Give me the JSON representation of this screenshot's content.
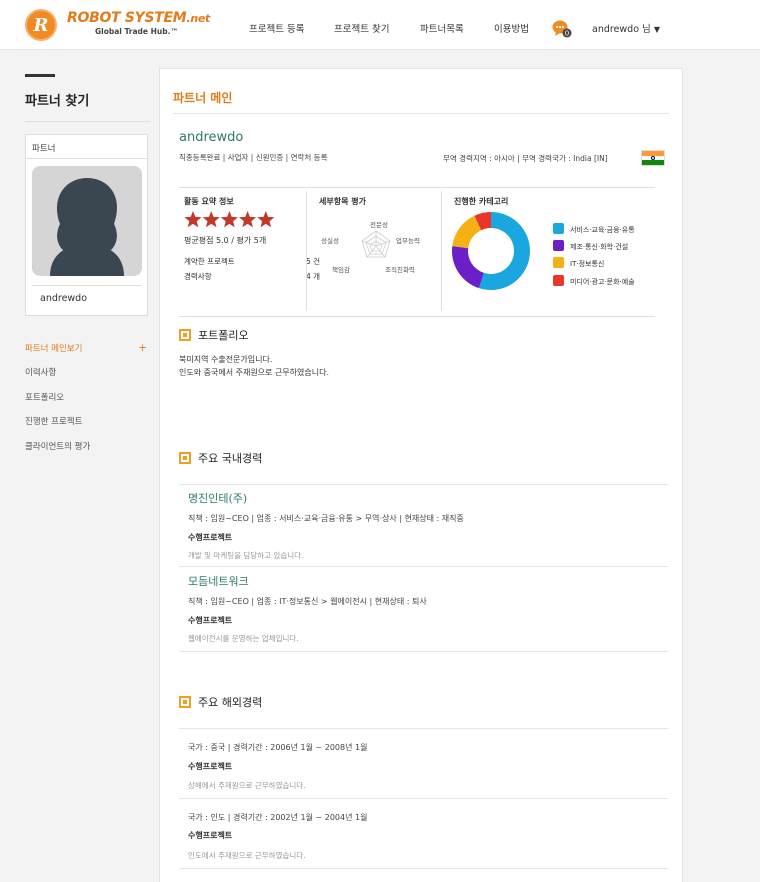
{
  "header": {
    "logo_text": "ROBOT SYSTEM",
    "logo_suffix": ".net",
    "logo_tagline": "Global Trade Hub.™",
    "nav": [
      "프로젝트 등록",
      "프로젝트 찾기",
      "파트너목록",
      "이용방법"
    ],
    "message_count": "0",
    "user_label": "andrewdo 님"
  },
  "sidebar": {
    "title": "파트너 찾기",
    "card_header": "파트너",
    "card_name": "andrewdo",
    "menu": [
      "파트너 메인보기",
      "이력사항",
      "포트폴리오",
      "진행한 프로젝트",
      "클라이언트의 평가"
    ],
    "plus": "+"
  },
  "main": {
    "title": "파트너 메인",
    "partner_name": "andrewdo",
    "tags": "직종등록완료 | 사업자 | 신원인증 | 연락처 등록",
    "region": "무역 경력지역 : 아시아   |   무역 경력국가 : India [IN]",
    "flag_colors": [
      "#ff9933",
      "#ffffff",
      "#138808"
    ]
  },
  "summary": {
    "title": "활동 요약 정보",
    "rating_stars": 5,
    "rating_color": "#c0392b",
    "avg_text": "평균평점 5.0 / 평가 5개",
    "contract_label": "계약한 프로젝트",
    "contract_value": "5 건",
    "career_label": "경력사항",
    "career_value": "4 개"
  },
  "radar": {
    "title": "세부항목 평가",
    "labels": [
      "전문성",
      "업무능력",
      "조직친화력",
      "책임감",
      "성실성"
    ]
  },
  "categories": {
    "title": "진행한 카테고리",
    "items": [
      {
        "label": "서비스·교육·금융·유통",
        "color": "#1aa7e0",
        "value": 55
      },
      {
        "label": "제조·통신·화학·건설",
        "color": "#6a1fc9",
        "value": 22
      },
      {
        "label": "IT·정보통신",
        "color": "#f5b014",
        "value": 16
      },
      {
        "label": "미디어·광고·문화·예술",
        "color": "#e8372a",
        "value": 7
      }
    ]
  },
  "portfolio": {
    "title": "포트폴리오",
    "lines": [
      "북미지역 수출전문가입니다.",
      "인도와 중국에서 주재원으로 근무하였습니다."
    ]
  },
  "domestic": {
    "title": "주요 국내경력",
    "entries": [
      {
        "company": "명진인테(주)",
        "meta": "직책 : 임원~CEO   |   업종 : 서비스·교육·금융·유통 > 무역·상사   |   현재상태 : 재직중",
        "project_label": "수행프로젝트",
        "desc": "개발 및 마케팅을 담당하고 있습니다."
      },
      {
        "company": "모듬네트워크",
        "meta": "직책 : 임원~CEO   |   업종 : IT·정보통신 > 웹에이전시   |   현재상태 : 퇴사",
        "project_label": "수행프로젝트",
        "desc": "웹에이전시를 운영하는 업체입니다."
      }
    ]
  },
  "overseas": {
    "title": "주요 해외경력",
    "entries": [
      {
        "meta": "국가 : 중국   |   경력기간 : 2006년 1월  ~  2008년 1월",
        "project_label": "수행프로젝트",
        "desc": "상해에서 주재원으로 근무하였습니다."
      },
      {
        "meta": "국가 : 인도   |   경력기간 : 2002년 1월  ~  2004년 1월",
        "project_label": "수행프로젝트",
        "desc": "인도에서 주재원으로 근무하였습니다."
      }
    ]
  }
}
